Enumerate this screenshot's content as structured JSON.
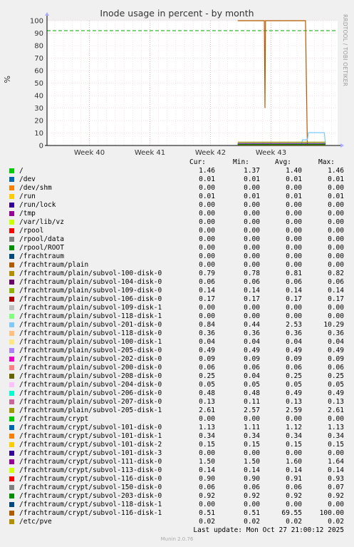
{
  "chart_data": {
    "type": "line",
    "title": "Inode usage in percent - by month",
    "ylabel": "%",
    "ylim": [
      0,
      100
    ],
    "yticks": [
      "0",
      "10",
      "20",
      "30",
      "40",
      "50",
      "60",
      "70",
      "80",
      "90",
      "100"
    ],
    "xticks": [
      "Week 40",
      "Week 41",
      "Week 42",
      "Week 43"
    ],
    "warning_level": 92,
    "side_label": "RRDTOOL / TOBI OETIKER",
    "columns": [
      "Cur:",
      "Min:",
      "Avg:",
      "Max:"
    ],
    "series": [
      {
        "name": "/",
        "color": "#00cc00",
        "cur": "1.46",
        "min": "1.37",
        "avg": "1.40",
        "max": "1.46"
      },
      {
        "name": "/dev",
        "color": "#0066b3",
        "cur": "0.01",
        "min": "0.01",
        "avg": "0.01",
        "max": "0.01"
      },
      {
        "name": "/dev/shm",
        "color": "#ff8000",
        "cur": "0.00",
        "min": "0.00",
        "avg": "0.00",
        "max": "0.00"
      },
      {
        "name": "/run",
        "color": "#ffcc00",
        "cur": "0.01",
        "min": "0.01",
        "avg": "0.01",
        "max": "0.01"
      },
      {
        "name": "/run/lock",
        "color": "#330099",
        "cur": "0.00",
        "min": "0.00",
        "avg": "0.00",
        "max": "0.00"
      },
      {
        "name": "/tmp",
        "color": "#990099",
        "cur": "0.00",
        "min": "0.00",
        "avg": "0.00",
        "max": "0.00"
      },
      {
        "name": "/var/lib/vz",
        "color": "#ccff00",
        "cur": "0.00",
        "min": "0.00",
        "avg": "0.00",
        "max": "0.00"
      },
      {
        "name": "/rpool",
        "color": "#ff0000",
        "cur": "0.00",
        "min": "0.00",
        "avg": "0.00",
        "max": "0.00"
      },
      {
        "name": "/rpool/data",
        "color": "#808080",
        "cur": "0.00",
        "min": "0.00",
        "avg": "0.00",
        "max": "0.00"
      },
      {
        "name": "/rpool/ROOT",
        "color": "#008f00",
        "cur": "0.00",
        "min": "0.00",
        "avg": "0.00",
        "max": "0.00"
      },
      {
        "name": "/frachtraum",
        "color": "#00487d",
        "cur": "0.00",
        "min": "0.00",
        "avg": "0.00",
        "max": "0.00"
      },
      {
        "name": "/frachtraum/plain",
        "color": "#b35a00",
        "cur": "0.00",
        "min": "0.00",
        "avg": "0.00",
        "max": "0.00"
      },
      {
        "name": "/frachtraum/plain/subvol-100-disk-0",
        "color": "#b38f00",
        "cur": "0.79",
        "min": "0.78",
        "avg": "0.81",
        "max": "0.82"
      },
      {
        "name": "/frachtraum/plain/subvol-104-disk-0",
        "color": "#6b006b",
        "cur": "0.06",
        "min": "0.06",
        "avg": "0.06",
        "max": "0.06"
      },
      {
        "name": "/frachtraum/plain/subvol-109-disk-0",
        "color": "#8fb300",
        "cur": "0.14",
        "min": "0.14",
        "avg": "0.14",
        "max": "0.14"
      },
      {
        "name": "/frachtraum/plain/subvol-106-disk-0",
        "color": "#b30000",
        "cur": "0.17",
        "min": "0.17",
        "avg": "0.17",
        "max": "0.17"
      },
      {
        "name": "/frachtraum/plain/subvol-109-disk-1",
        "color": "#bebebe",
        "cur": "0.00",
        "min": "0.00",
        "avg": "0.00",
        "max": "0.00"
      },
      {
        "name": "/frachtraum/plain/subvol-118-disk-1",
        "color": "#80ff80",
        "cur": "0.00",
        "min": "0.00",
        "avg": "0.00",
        "max": "0.00"
      },
      {
        "name": "/frachtraum/plain/subvol-201-disk-0",
        "color": "#80c9ff",
        "cur": "0.84",
        "min": "0.44",
        "avg": "2.53",
        "max": "10.29"
      },
      {
        "name": "/frachtraum/plain/subvol-118-disk-0",
        "color": "#ffc080",
        "cur": "0.36",
        "min": "0.36",
        "avg": "0.36",
        "max": "0.36"
      },
      {
        "name": "/frachtraum/plain/subvol-100-disk-1",
        "color": "#ffe680",
        "cur": "0.04",
        "min": "0.04",
        "avg": "0.04",
        "max": "0.04"
      },
      {
        "name": "/frachtraum/plain/subvol-205-disk-0",
        "color": "#aa80ff",
        "cur": "0.49",
        "min": "0.49",
        "avg": "0.49",
        "max": "0.49"
      },
      {
        "name": "/frachtraum/plain/subvol-202-disk-0",
        "color": "#ee00cc",
        "cur": "0.09",
        "min": "0.09",
        "avg": "0.09",
        "max": "0.09"
      },
      {
        "name": "/frachtraum/plain/subvol-200-disk-0",
        "color": "#ff8080",
        "cur": "0.06",
        "min": "0.06",
        "avg": "0.06",
        "max": "0.06"
      },
      {
        "name": "/frachtraum/plain/subvol-208-disk-0",
        "color": "#666600",
        "cur": "0.25",
        "min": "0.04",
        "avg": "0.25",
        "max": "0.25"
      },
      {
        "name": "/frachtraum/plain/subvol-204-disk-0",
        "color": "#ffbfff",
        "cur": "0.05",
        "min": "0.05",
        "avg": "0.05",
        "max": "0.05"
      },
      {
        "name": "/frachtraum/plain/subvol-206-disk-0",
        "color": "#00ffcc",
        "cur": "0.48",
        "min": "0.48",
        "avg": "0.49",
        "max": "0.49"
      },
      {
        "name": "/frachtraum/plain/subvol-207-disk-0",
        "color": "#cc6699",
        "cur": "0.13",
        "min": "0.11",
        "avg": "0.13",
        "max": "0.13"
      },
      {
        "name": "/frachtraum/plain/subvol-205-disk-1",
        "color": "#999900",
        "cur": "2.61",
        "min": "2.57",
        "avg": "2.59",
        "max": "2.61"
      },
      {
        "name": "/frachtraum/crypt",
        "color": "#00cc00",
        "cur": "0.00",
        "min": "0.00",
        "avg": "0.00",
        "max": "0.00"
      },
      {
        "name": "/frachtraum/crypt/subvol-101-disk-0",
        "color": "#0066b3",
        "cur": "1.13",
        "min": "1.11",
        "avg": "1.12",
        "max": "1.13"
      },
      {
        "name": "/frachtraum/crypt/subvol-101-disk-1",
        "color": "#ff8000",
        "cur": "0.34",
        "min": "0.34",
        "avg": "0.34",
        "max": "0.34"
      },
      {
        "name": "/frachtraum/crypt/subvol-101-disk-2",
        "color": "#ffcc00",
        "cur": "0.15",
        "min": "0.15",
        "avg": "0.15",
        "max": "0.15"
      },
      {
        "name": "/frachtraum/crypt/subvol-101-disk-3",
        "color": "#330099",
        "cur": "0.00",
        "min": "0.00",
        "avg": "0.00",
        "max": "0.00"
      },
      {
        "name": "/frachtraum/crypt/subvol-111-disk-0",
        "color": "#990099",
        "cur": "1.50",
        "min": "1.50",
        "avg": "1.60",
        "max": "1.64"
      },
      {
        "name": "/frachtraum/crypt/subvol-113-disk-0",
        "color": "#ccff00",
        "cur": "0.14",
        "min": "0.14",
        "avg": "0.14",
        "max": "0.14"
      },
      {
        "name": "/frachtraum/crypt/subvol-116-disk-0",
        "color": "#ff0000",
        "cur": "0.90",
        "min": "0.90",
        "avg": "0.91",
        "max": "0.93"
      },
      {
        "name": "/frachtraum/crypt/subvol-150-disk-0",
        "color": "#808080",
        "cur": "0.06",
        "min": "0.06",
        "avg": "0.06",
        "max": "0.07"
      },
      {
        "name": "/frachtraum/crypt/subvol-203-disk-0",
        "color": "#008f00",
        "cur": "0.92",
        "min": "0.92",
        "avg": "0.92",
        "max": "0.92"
      },
      {
        "name": "/frachtraum/crypt/subvol-118-disk-1",
        "color": "#00487d",
        "cur": "0.00",
        "min": "0.00",
        "avg": "0.00",
        "max": "0.00"
      },
      {
        "name": "/frachtraum/crypt/subvol-116-disk-1",
        "color": "#b35a00",
        "cur": "0.51",
        "min": "0.51",
        "avg": "69.55",
        "max": "100.00"
      },
      {
        "name": "/etc/pve",
        "color": "#b38f00",
        "cur": "0.02",
        "min": "0.02",
        "avg": "0.02",
        "max": "0.02"
      }
    ],
    "plotted_lines": [
      {
        "series": "/frachtraum/crypt/subvol-116-disk-1",
        "color": "#b35a00",
        "x": [
          42.45,
          42.89,
          42.9,
          42.91,
          43.57,
          43.6
        ],
        "y": [
          100,
          100,
          30,
          100,
          100,
          0.51
        ]
      },
      {
        "series": "/frachtraum/plain/subvol-201-disk-0",
        "color": "#80c9ff",
        "x": [
          42.45,
          43.5,
          43.52,
          43.6,
          43.62,
          43.88,
          43.9
        ],
        "y": [
          0.5,
          0.5,
          4.5,
          4.5,
          10.29,
          10.29,
          0.84
        ]
      },
      {
        "series": "/frachtraum/plain/subvol-205-disk-1",
        "color": "#999900",
        "x": [
          42.45,
          43.9
        ],
        "y": [
          2.6,
          2.61
        ]
      },
      {
        "series": "/",
        "color": "#00cc00",
        "x": [
          42.45,
          43.9
        ],
        "y": [
          1.4,
          1.46
        ]
      },
      {
        "series": "/frachtraum/crypt/subvol-111-disk-0",
        "color": "#990099",
        "x": [
          42.45,
          43.9
        ],
        "y": [
          1.6,
          1.5
        ]
      },
      {
        "series": "/frachtraum/crypt/subvol-101-disk-0",
        "color": "#0066b3",
        "x": [
          42.45,
          43.9
        ],
        "y": [
          1.12,
          1.13
        ]
      }
    ]
  },
  "legend_header": {
    "cur": "Cur:",
    "min": "Min:",
    "avg": "Avg:",
    "max": "Max:"
  },
  "footer": {
    "last_update": "Last update: Mon Oct 27 21:00:12 2025",
    "version": "Munin 2.0.76"
  }
}
